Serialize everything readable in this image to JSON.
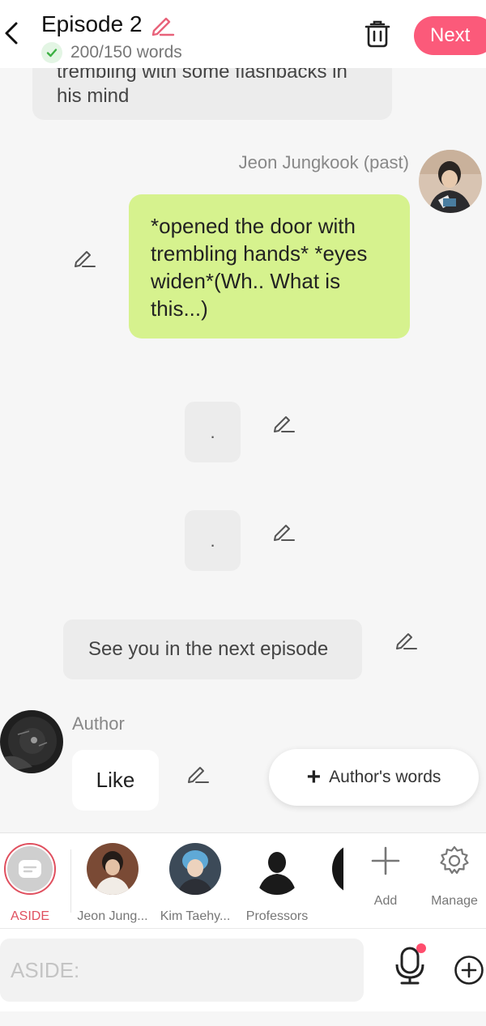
{
  "header": {
    "episode_title": "Episode 2",
    "word_count": "200/150 words",
    "next_label": "Next"
  },
  "messages": {
    "narration_top": "trembling with some flashbacks in his mind",
    "speaker_name": "Jeon Jungkook (past)",
    "green_bubble": "*opened the door with trembling hands* *eyes widen*(Wh.. What is this...)",
    "dot_bubble_1": ".",
    "dot_bubble_2": ".",
    "aside_bubble": "See you in the next episode",
    "author_name": "Author",
    "author_bubble": "Like",
    "authors_words_label": "Author's words"
  },
  "cast": {
    "aside_label": "ASIDE",
    "items": [
      {
        "label": "Jeon Jung..."
      },
      {
        "label": "Kim Taehy..."
      },
      {
        "label": "Professors"
      }
    ],
    "add_label": "Add",
    "manage_label": "Manage"
  },
  "input": {
    "placeholder": "ASIDE:",
    "value": ""
  },
  "colors": {
    "accent": "#fb5a7a",
    "aside_red": "#e0505f",
    "green_bubble": "#d6f28e",
    "check_green": "#3cb043"
  }
}
